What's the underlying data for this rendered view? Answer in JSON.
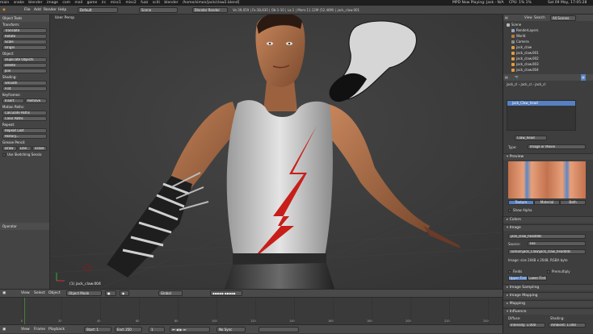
{
  "os_bar": {
    "items": [
      "main",
      "snake",
      "blender",
      "image",
      "com",
      "mail",
      "game",
      "irc",
      "misc1",
      "misc2",
      "fuzz",
      "sciti",
      "blender"
    ],
    "path": "/home/simon/jack/claw2.blend]",
    "now_playing": "MPD Now Playing: Jask - N/A",
    "cpu": "CPU: 1% 1%",
    "datetime": "Sat 09 May, 17:05:28"
  },
  "info_header": {
    "menus": [
      "File",
      "Add",
      "Render",
      "Help"
    ],
    "screen": "Default",
    "scene": "Scene",
    "engine": "Blender Render",
    "stats": "Ve:39,059 | Fa:38,830 | Ob:1-10 | La:1 | Mem:11.12M (52.46M) | jack_claw.001"
  },
  "toolshelf": {
    "title": "Object Tools",
    "transform_label": "Transform:",
    "transform_buttons": [
      "Translate",
      "Rotate",
      "Scale",
      "Origin"
    ],
    "object_label": "Object:",
    "object_buttons": [
      "Duplicate Objects",
      "Delete",
      "Join"
    ],
    "shading_label": "Shading:",
    "shading_buttons": [
      "Smooth",
      "Flat"
    ],
    "keyframes_label": "Keyframes:",
    "keyframes_buttons": [
      "Insert",
      "Remove"
    ],
    "motion_label": "Motion Paths:",
    "motion_buttons": [
      "Calculate Paths",
      "Clear Paths"
    ],
    "repeat_label": "Repeat:",
    "repeat_buttons": [
      "Repeat Last",
      "History..."
    ],
    "grease_label": "Grease Pencil:",
    "grease_buttons": [
      "Draw",
      "Line",
      "Erase"
    ],
    "sketching": "Use Sketching Sessio",
    "operator": "Operator"
  },
  "viewport": {
    "title": "User Persp",
    "object_label": "(1) jack_claw.004"
  },
  "view3d_header": {
    "menus": [
      "View",
      "Select",
      "Object"
    ],
    "mode": "Object Mode",
    "pivot": "Global"
  },
  "timeline": {
    "numbers": [
      "0",
      "20",
      "40",
      "60",
      "80",
      "100",
      "120",
      "140",
      "160",
      "180",
      "200",
      "220",
      "240"
    ]
  },
  "timeline_header": {
    "menus": [
      "View",
      "Frame",
      "Playback"
    ],
    "start": "Start: 1",
    "end": "End: 250",
    "current": "1",
    "sync": "No Sync"
  },
  "outliner": {
    "menus": [
      "View",
      "Search"
    ],
    "filter": "All Scenes",
    "items": [
      {
        "label": "Scene",
        "color": "#b7b7b7"
      },
      {
        "label": "RenderLayers",
        "color": "#9aa5c2"
      },
      {
        "label": "World",
        "color": "#b97a3a"
      },
      {
        "label": "Camera",
        "color": "#8a8a8a"
      },
      {
        "label": "jack_claw",
        "color": "#e39c3c"
      },
      {
        "label": "jack_claw.001",
        "color": "#e39c3c"
      },
      {
        "label": "jack_claw.002",
        "color": "#e39c3c"
      },
      {
        "label": "jack_claw.003",
        "color": "#e39c3c"
      },
      {
        "label": "jack_claw.004",
        "color": "#e39c3c"
      }
    ]
  },
  "properties": {
    "breadcrumb": [
      "jack_cl",
      "jack_cl",
      "jack_cl"
    ],
    "texture_slot": "jack_Claw_head",
    "texture_name": "Claw_head",
    "type_label": "Type:",
    "type_value": "Image or Movie",
    "preview_label": "Preview",
    "preview_tabs": [
      "Texture",
      "Material",
      "Both"
    ],
    "show_alpha": "Show Alpha",
    "colors_label": "Colors",
    "image_label": "Image",
    "image_field": "jack_claw_headdds",
    "source_label": "Source:",
    "source_value": "File",
    "filepath": "\\simon\\jack_Claw\\jack_claw_headdds",
    "image_info": "Image: size 2048 x 2048, RGBA byte",
    "fields": "Fields",
    "premultiply": "Premultiply",
    "upper_first": "Upper First",
    "lower_first": "Lower First",
    "image_sampling": "Image Sampling",
    "image_mapping": "Image Mapping",
    "mapping": "Mapping",
    "influence": "Influence",
    "diffuse": "Diffuse:",
    "shading": "Shading:",
    "intensity": "Intensity: 1.000",
    "ambient": "Ambient: 1.000"
  }
}
